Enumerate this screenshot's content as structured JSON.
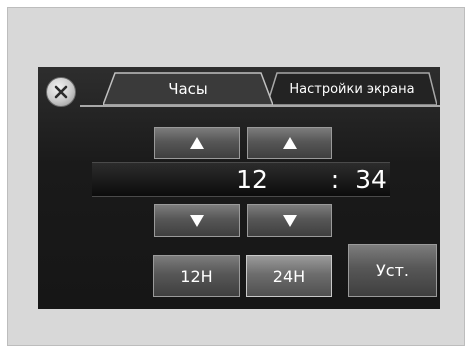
{
  "tabs": {
    "clock": "Часы",
    "display_settings": "Настройки экрана"
  },
  "time": {
    "hours": "12",
    "separator": ":",
    "minutes": "34"
  },
  "buttons": {
    "mode_12h": "12H",
    "mode_24h": "24H",
    "set": "Уст."
  },
  "state": {
    "active_tab": "clock",
    "selected_mode": "24H"
  },
  "icons": {
    "close": "close-icon",
    "up": "arrow-up-icon",
    "down": "arrow-down-icon"
  },
  "colors": {
    "screen": "#141414",
    "text": "#ffffff",
    "frame": "#d8d8d8"
  }
}
